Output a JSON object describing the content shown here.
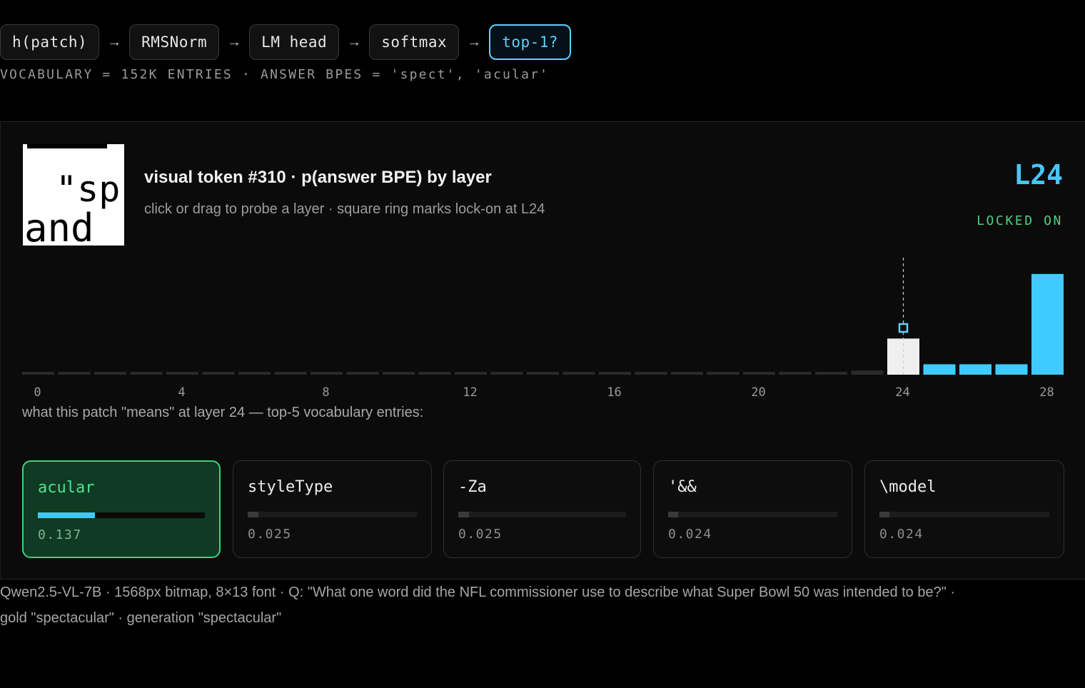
{
  "pipeline": [
    {
      "label": "h(patch)",
      "active": false
    },
    {
      "label": "RMSNorm",
      "active": false
    },
    {
      "label": "LM head",
      "active": false
    },
    {
      "label": "softmax",
      "active": false
    },
    {
      "label": "top-1?",
      "active": true
    }
  ],
  "arrow_glyph": "→",
  "vocab_line": "VOCABULARY = 152K ENTRIES · ANSWER BPES = 'spect', 'acular'",
  "panel": {
    "title": "visual token #310 · p(answer BPE) by layer",
    "subtitle": "click or drag to probe a layer · square ring marks lock-on at L24",
    "layer_tag": "L24",
    "status": "LOCKED ON",
    "means_caption": "what this patch \"means\" at layer 24 — top-5 vocabulary entries:"
  },
  "thumbnail": {
    "lines": [
      "\"sp",
      "and"
    ]
  },
  "chart_data": {
    "type": "bar",
    "title": "visual token #310 · p(answer BPE) by layer",
    "x": [
      0,
      1,
      2,
      3,
      4,
      5,
      6,
      7,
      8,
      9,
      10,
      11,
      12,
      13,
      14,
      15,
      16,
      17,
      18,
      19,
      20,
      21,
      22,
      23,
      24,
      25,
      26,
      27,
      28
    ],
    "values": [
      0.003,
      0.003,
      0.003,
      0.003,
      0.003,
      0.003,
      0.003,
      0.003,
      0.003,
      0.003,
      0.003,
      0.003,
      0.003,
      0.003,
      0.003,
      0.003,
      0.003,
      0.003,
      0.003,
      0.003,
      0.003,
      0.003,
      0.003,
      0.006,
      0.052,
      0.015,
      0.015,
      0.015,
      0.145
    ],
    "xticks": [
      0,
      4,
      8,
      12,
      16,
      20,
      24,
      28
    ],
    "xtick_labels": [
      "0",
      "4",
      "8",
      "12",
      "16",
      "20",
      "24",
      "28"
    ],
    "ylim": [
      0,
      0.15
    ],
    "selected_layer": 24,
    "lock_on_layer": 24,
    "grid": false,
    "colors": {
      "baseline": "#2a2a2a",
      "after_lock": "#3fcbff",
      "selected": "#efefef",
      "marker": "#5fd0ff"
    }
  },
  "top5": [
    {
      "token": "acular",
      "prob": 0.137,
      "prob_label": "0.137",
      "top": true
    },
    {
      "token": "styleType",
      "prob": 0.025,
      "prob_label": "0.025",
      "top": false
    },
    {
      "token": "-Za",
      "prob": 0.025,
      "prob_label": "0.025",
      "top": false
    },
    {
      "token": "'&&",
      "prob": 0.024,
      "prob_label": "0.024",
      "top": false
    },
    {
      "token": "\\model",
      "prob": 0.024,
      "prob_label": "0.024",
      "top": false
    }
  ],
  "footer": {
    "line1": "Qwen2.5-VL-7B · 1568px bitmap, 8×13 font · Q: \"What one word did the NFL commissioner use to describe what Super Bowl 50 was intended to be?\" ·",
    "line2": "gold \"spectacular\" · generation \"spectacular\""
  }
}
